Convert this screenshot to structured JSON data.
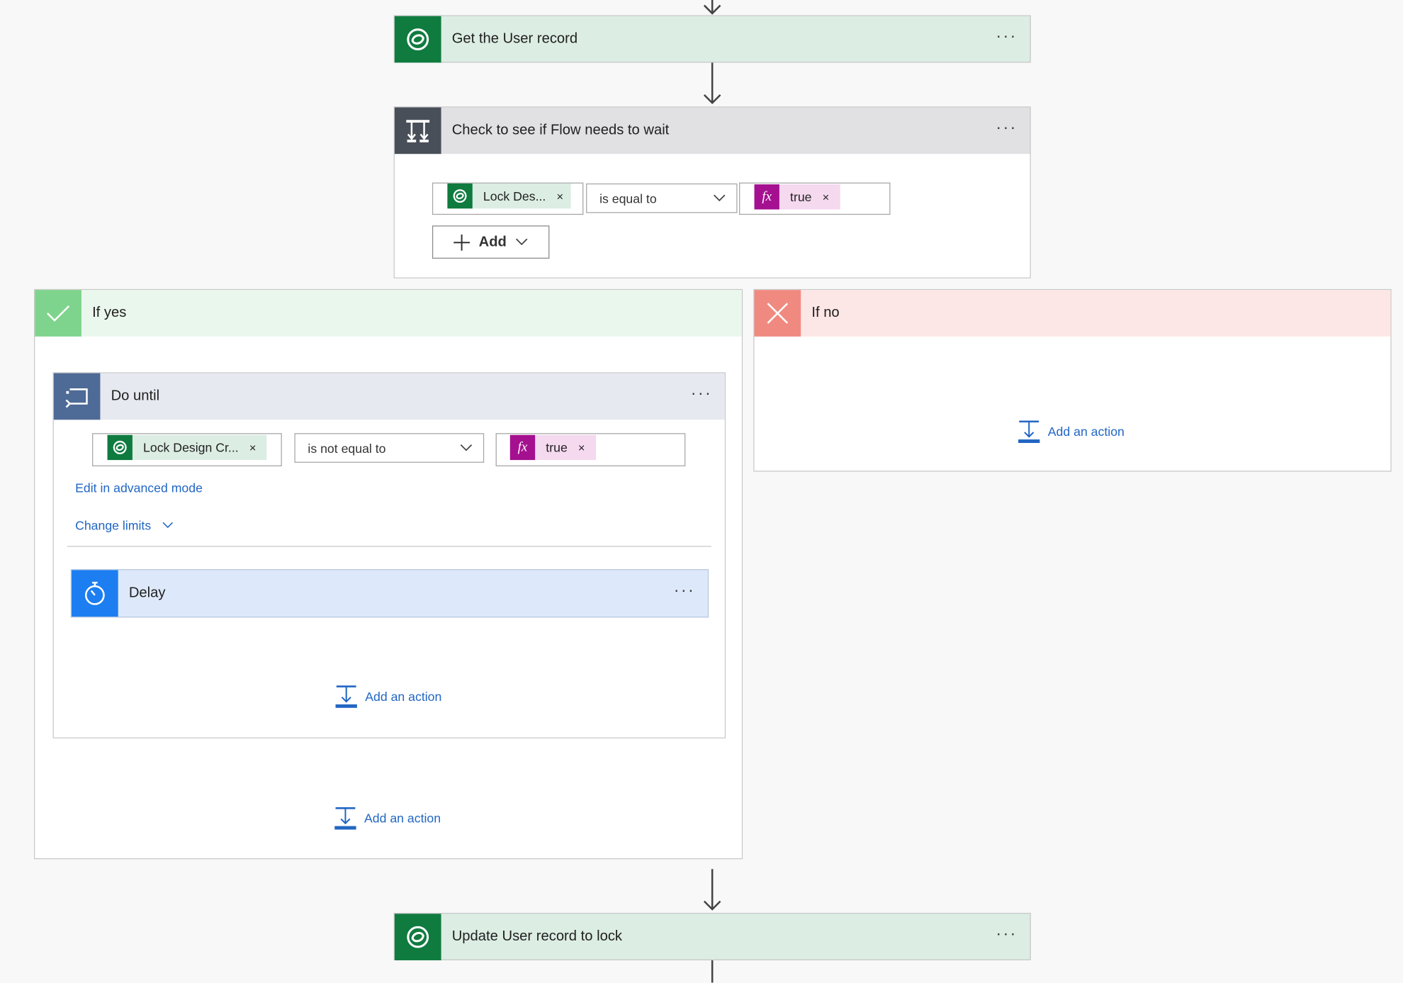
{
  "steps": {
    "get_user": {
      "title": "Get the User record",
      "more": "···"
    },
    "condition": {
      "title": "Check to see if Flow needs to wait",
      "more": "···",
      "left_token": "Lock Des...",
      "operator": "is equal to",
      "right_token": "true",
      "add_label": "Add"
    },
    "if_yes": {
      "title": "If yes",
      "do_until": {
        "title": "Do until",
        "more": "···",
        "left_token": "Lock Design Cr...",
        "operator": "is not equal to",
        "right_token": "true",
        "advanced_link": "Edit in advanced mode",
        "limits_link": "Change limits",
        "delay": {
          "title": "Delay",
          "more": "···"
        },
        "inner_add_action": "Add an action"
      },
      "add_action": "Add an action"
    },
    "if_no": {
      "title": "If no",
      "add_action": "Add an action"
    },
    "update_user": {
      "title": "Update User record to lock",
      "more": "···"
    }
  },
  "token_close": "×",
  "fx_symbol": "fx",
  "colors": {
    "dataverse_green": "#0f7b3f",
    "dataverse_header_bg": "#dcede3",
    "condition_dark": "#484f58",
    "condition_header_bg": "#e1e1e4",
    "yes_green": "#7ed48c",
    "yes_header_bg": "#eaf7ec",
    "no_red": "#f08a80",
    "no_header_bg": "#fde7e6",
    "loop_blue": "#4e6a96",
    "loop_header_bg": "#e6e9f0",
    "delay_blue": "#1c7ef0",
    "delay_header_bg": "#dde9fb",
    "fx_magenta": "#a4108f",
    "fx_token_bg": "#f5d9ef",
    "link_blue": "#2266c3"
  }
}
